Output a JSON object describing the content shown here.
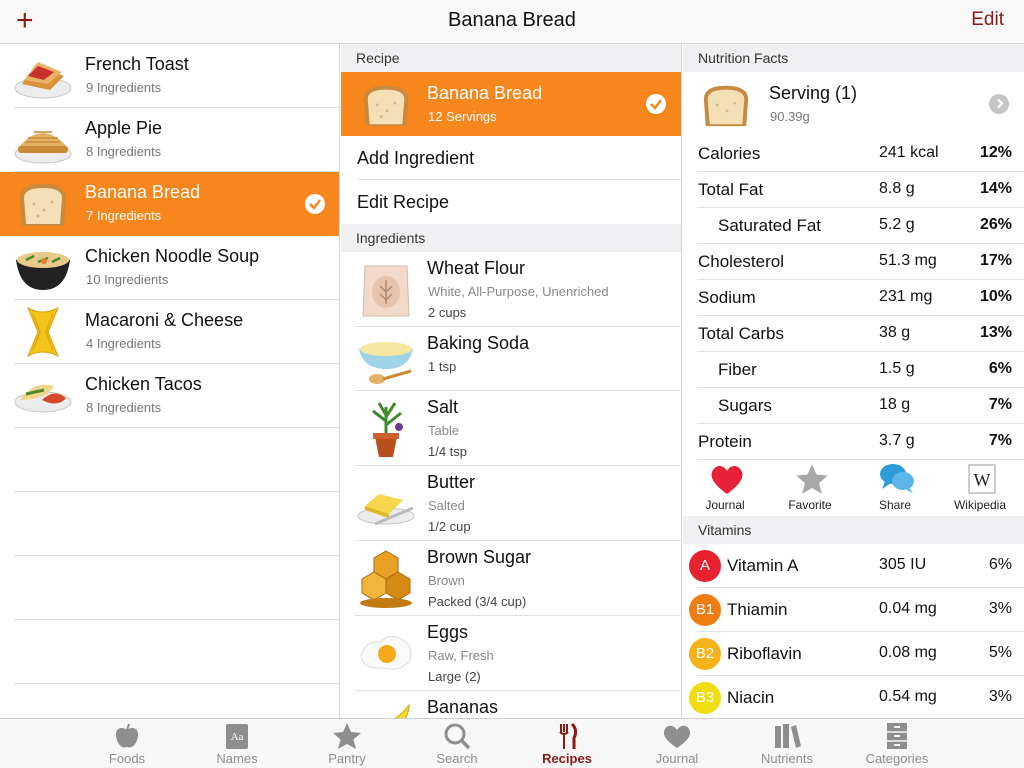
{
  "nav": {
    "add_label": "+",
    "title": "Banana Bread",
    "edit_label": "Edit"
  },
  "foods": [
    {
      "name": "French Toast",
      "sub": "9 Ingredients",
      "icon": "french-toast-icon"
    },
    {
      "name": "Apple Pie",
      "sub": "8 Ingredients",
      "icon": "apple-pie-icon"
    },
    {
      "name": "Banana Bread",
      "sub": "7 Ingredients",
      "icon": "bread-icon",
      "selected": true
    },
    {
      "name": "Chicken Noodle Soup",
      "sub": "10 Ingredients",
      "icon": "soup-icon"
    },
    {
      "name": "Macaroni & Cheese",
      "sub": "4 Ingredients",
      "icon": "pasta-icon"
    },
    {
      "name": "Chicken Tacos",
      "sub": "8 Ingredients",
      "icon": "taco-icon"
    }
  ],
  "recipe": {
    "header": "Recipe",
    "name": "Banana Bread",
    "servings": "12 Servings",
    "add_ingredient": "Add Ingredient",
    "edit_recipe": "Edit Recipe",
    "ingredients_header": "Ingredients",
    "ingredients": [
      {
        "name": "Wheat Flour",
        "l2": "White, All-Purpose, Unenriched",
        "l3": "2 cups",
        "icon": "flour-icon"
      },
      {
        "name": "Baking Soda",
        "l2": "",
        "l3": "1 tsp",
        "icon": "baking-soda-icon"
      },
      {
        "name": "Salt",
        "l2": "Table",
        "l3": "1/4 tsp",
        "icon": "salt-plant-icon"
      },
      {
        "name": "Butter",
        "l2": "Salted",
        "l3": "1/2 cup",
        "icon": "butter-icon"
      },
      {
        "name": "Brown Sugar",
        "l2": "Brown",
        "l3": "Packed (3/4 cup)",
        "icon": "honeycomb-icon"
      },
      {
        "name": "Eggs",
        "l2": "Raw, Fresh",
        "l3": "Large (2)",
        "icon": "egg-icon"
      },
      {
        "name": "Bananas",
        "l2": "",
        "l3": "",
        "icon": "banana-icon"
      }
    ]
  },
  "nutrition": {
    "header": "Nutrition Facts",
    "serving_name": "Serving (1)",
    "serving_weight": "90.39g",
    "rows": [
      {
        "label": "Calories",
        "amount": "241 kcal",
        "pct": "12%",
        "indent": false
      },
      {
        "label": "Total Fat",
        "amount": "8.8 g",
        "pct": "14%",
        "indent": false
      },
      {
        "label": "Saturated Fat",
        "amount": "5.2 g",
        "pct": "26%",
        "indent": true
      },
      {
        "label": "Cholesterol",
        "amount": "51.3 mg",
        "pct": "17%",
        "indent": false
      },
      {
        "label": "Sodium",
        "amount": "231 mg",
        "pct": "10%",
        "indent": false
      },
      {
        "label": "Total Carbs",
        "amount": "38 g",
        "pct": "13%",
        "indent": false
      },
      {
        "label": "Fiber",
        "amount": "1.5 g",
        "pct": "6%",
        "indent": true
      },
      {
        "label": "Sugars",
        "amount": "18 g",
        "pct": "7%",
        "indent": true
      },
      {
        "label": "Protein",
        "amount": "3.7 g",
        "pct": "7%",
        "indent": false
      }
    ],
    "actions": [
      {
        "label": "Journal",
        "icon": "heart-icon"
      },
      {
        "label": "Favorite",
        "icon": "star-icon"
      },
      {
        "label": "Share",
        "icon": "chat-bubbles-icon"
      },
      {
        "label": "Wikipedia",
        "icon": "wikipedia-icon"
      }
    ],
    "vitamins_header": "Vitamins",
    "vitamins": [
      {
        "badge": "A",
        "label": "Vitamin A",
        "amount": "305 IU",
        "pct": "6%",
        "color": "#e8212f"
      },
      {
        "badge": "B1",
        "label": "Thiamin",
        "amount": "0.04 mg",
        "pct": "3%",
        "color": "#ef7d14"
      },
      {
        "badge": "B2",
        "label": "Riboflavin",
        "amount": "0.08 mg",
        "pct": "5%",
        "color": "#f7b21a"
      },
      {
        "badge": "B3",
        "label": "Niacin",
        "amount": "0.54 mg",
        "pct": "3%",
        "color": "#f0dd10"
      }
    ]
  },
  "tabs": [
    {
      "label": "Foods",
      "icon": "apple-icon"
    },
    {
      "label": "Names",
      "icon": "dictionary-icon"
    },
    {
      "label": "Pantry",
      "icon": "star-icon"
    },
    {
      "label": "Search",
      "icon": "search-icon"
    },
    {
      "label": "Recipes",
      "icon": "fork-knife-icon",
      "active": true
    },
    {
      "label": "Journal",
      "icon": "heart-icon"
    },
    {
      "label": "Nutrients",
      "icon": "books-icon"
    },
    {
      "label": "Categories",
      "icon": "cabinet-icon"
    }
  ],
  "colors": {
    "accent": "#f7861c",
    "brand": "#8a1a14",
    "separator": "#e1e1e1"
  }
}
